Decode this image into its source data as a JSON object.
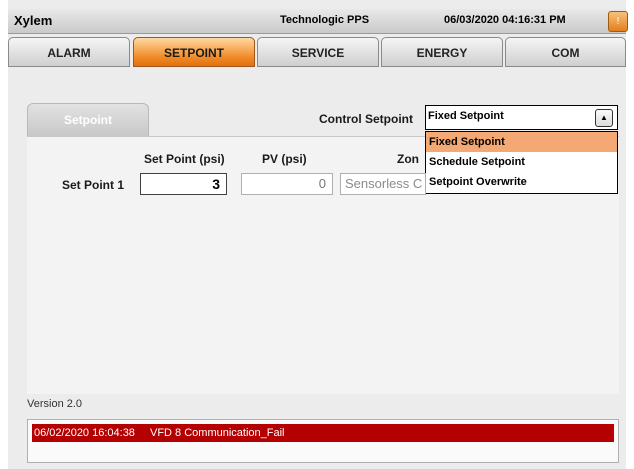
{
  "header": {
    "brand": "Xylem",
    "app_name": "Technologic PPS",
    "datetime": "06/03/2020 04:16:31 PM",
    "corner_button": "!"
  },
  "tabs": [
    {
      "label": "ALARM",
      "active": false
    },
    {
      "label": "SETPOINT",
      "active": true
    },
    {
      "label": "SERVICE",
      "active": false
    },
    {
      "label": "ENERGY",
      "active": false
    },
    {
      "label": "COM",
      "active": false
    }
  ],
  "section_tab": "Setpoint",
  "control_setpoint": {
    "label": "Control Setpoint",
    "selected": "Fixed Setpoint",
    "options": [
      "Fixed Setpoint",
      "Schedule Setpoint",
      "Setpoint Overwrite"
    ]
  },
  "table": {
    "headers": [
      "Set Point (psi)",
      "PV (psi)",
      "Zon"
    ],
    "row_label": "Set Point 1",
    "set_point_value": "3",
    "pv_value": "0",
    "zone_value": "Sensorless C"
  },
  "version": "Version 2.0",
  "alarm": {
    "timestamp": "06/02/2020 16:04:38",
    "message": "VFD 8 Communication_Fail",
    "color": "#b40000"
  },
  "colors": {
    "accent": "#f08a25"
  }
}
